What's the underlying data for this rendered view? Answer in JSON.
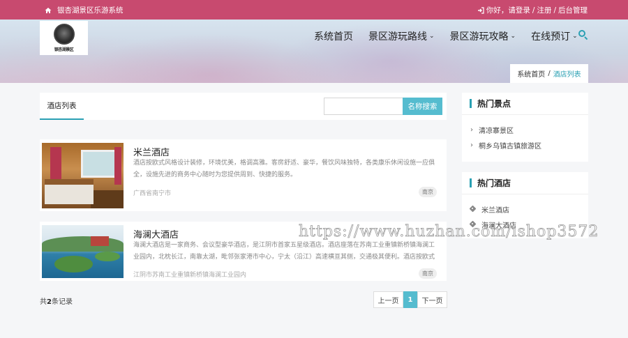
{
  "topbar": {
    "site_icon": "home-icon",
    "site_name": "银杏湖景区乐游系统",
    "login_icon": "sign-in-icon",
    "greeting": "你好，请登录",
    "sep1": "/",
    "register": "注册",
    "sep2": "/",
    "admin": "后台管理"
  },
  "logo": {
    "text": "银杏湖景区",
    "icon": "logo-emblem-icon"
  },
  "nav": {
    "items": [
      {
        "label": "系统首页",
        "dropdown": false
      },
      {
        "label": "景区游玩路线",
        "dropdown": true
      },
      {
        "label": "景区游玩攻略",
        "dropdown": true
      },
      {
        "label": "在线预订",
        "dropdown": true
      }
    ],
    "caret": "⌄",
    "search_icon": "search-icon"
  },
  "breadcrumb": {
    "home": "系统首页",
    "sep": "/",
    "current": "酒店列表"
  },
  "list": {
    "tab": "酒店列表",
    "search_placeholder": "",
    "search_button": "名称搜索"
  },
  "hotels": [
    {
      "name": "米兰酒店",
      "desc": "酒店按欧式风格设计装修，环境优美，格调高雅。客房舒适、豪华，餐饮风味独特，各类康乐休闲设施一应俱全，设施先进的商务中心随时为您提供周到、快捷的服务。",
      "location": "广西省南宁市",
      "tag": "南京"
    },
    {
      "name": "海澜大酒店",
      "desc": "海澜大酒店是一家商务、会议型豪华酒店，是江阴市首家五星级酒店。酒店座落在苏南工业重镇新桥镇海澜工业园内，北枕长江，南靠太湖，毗邻张家港市中心，宁太（沿江）高速横亘其侧，交通极其便利。酒店按欧式",
      "location": "江阴市苏南工业重镇新桥镇海澜工业园内",
      "tag": "南京"
    }
  ],
  "pagination": {
    "total_prefix": "共",
    "total": "2",
    "total_suffix": "条记录",
    "prev": "上一页",
    "current": "1",
    "next": "下一页"
  },
  "sidebar": {
    "spots": {
      "title": "热门景点",
      "items": [
        "清凉寨景区",
        "桐乡乌镇古镇旅游区"
      ]
    },
    "hotels": {
      "title": "热门酒店",
      "items": [
        "米兰酒店",
        "海澜大酒店"
      ]
    }
  },
  "watermark": "https://www.huzhan.com/ishop3572",
  "colors": {
    "topbar": "#c84a6f",
    "accent": "#2aa0b3",
    "button": "#55bccf"
  }
}
